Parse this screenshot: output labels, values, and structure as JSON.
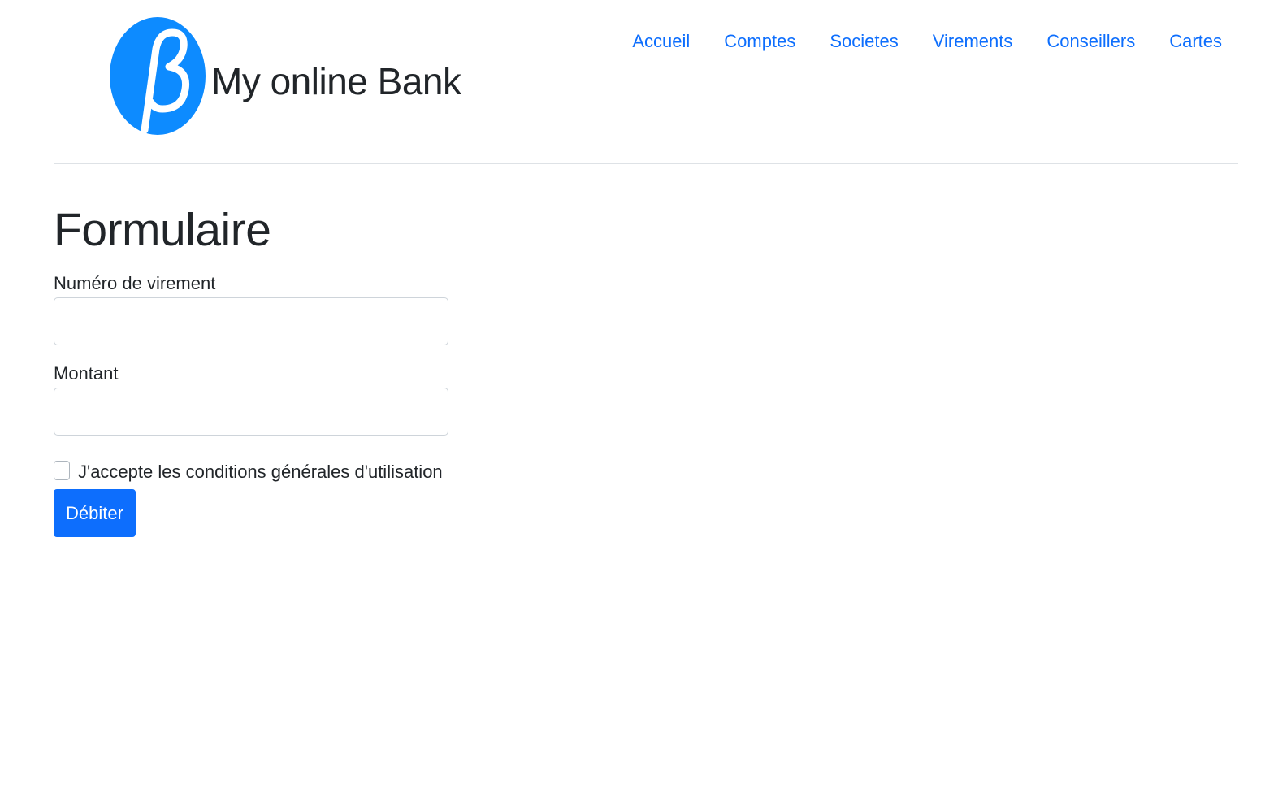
{
  "header": {
    "brand_name": "My online Bank",
    "logo_glyph": "β",
    "logo_icon": "beta-logo-icon",
    "nav": [
      {
        "label": "Accueil"
      },
      {
        "label": "Comptes"
      },
      {
        "label": "Societes"
      },
      {
        "label": "Virements"
      },
      {
        "label": "Conseillers"
      },
      {
        "label": "Cartes"
      }
    ]
  },
  "main": {
    "title": "Formulaire",
    "fields": [
      {
        "label": "Numéro de virement",
        "value": "",
        "placeholder": ""
      },
      {
        "label": "Montant",
        "value": "",
        "placeholder": ""
      }
    ],
    "terms_label": "J'accepte les conditions générales d'utilisation",
    "terms_checked": false,
    "submit_label": "Débiter"
  },
  "colors": {
    "link": "#0d6efd",
    "primary_button": "#0d6efd",
    "logo_blue": "#0d8bff",
    "divider": "#dee2e6"
  }
}
